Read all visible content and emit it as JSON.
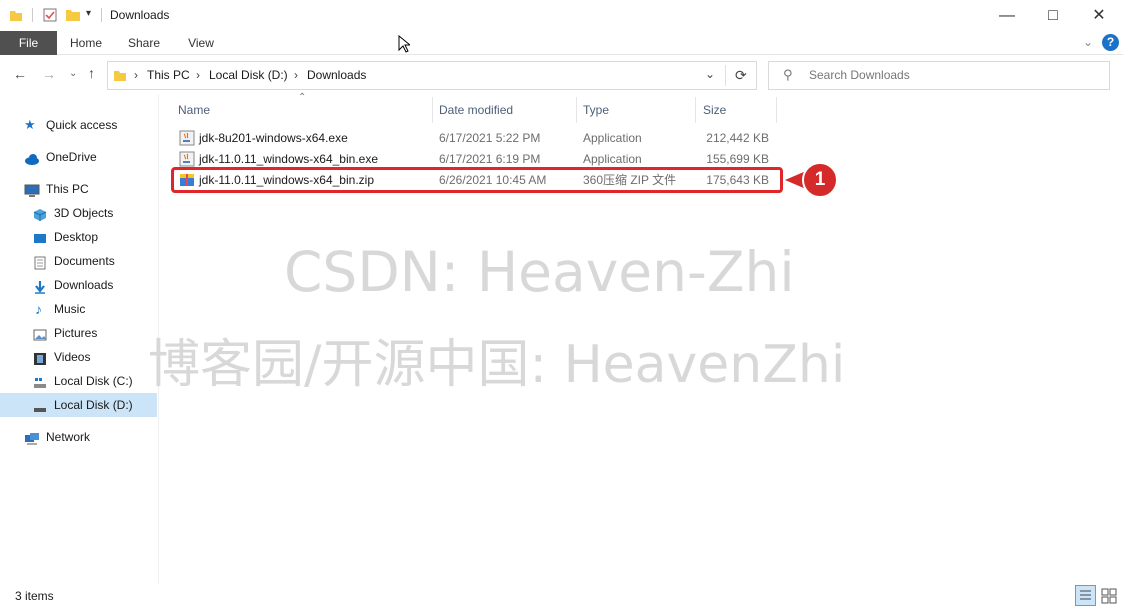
{
  "window": {
    "title": "Downloads"
  },
  "ribbon": {
    "tabs": [
      "File",
      "Home",
      "Share",
      "View"
    ]
  },
  "address": {
    "crumbs": [
      "This PC",
      "Local Disk (D:)",
      "Downloads"
    ]
  },
  "search": {
    "placeholder": "Search Downloads"
  },
  "sidebar": {
    "items": [
      {
        "label": "Quick access"
      },
      {
        "label": "OneDrive"
      },
      {
        "label": "This PC"
      },
      {
        "label": "3D Objects"
      },
      {
        "label": "Desktop"
      },
      {
        "label": "Documents"
      },
      {
        "label": "Downloads"
      },
      {
        "label": "Music"
      },
      {
        "label": "Pictures"
      },
      {
        "label": "Videos"
      },
      {
        "label": "Local Disk (C:)"
      },
      {
        "label": "Local Disk (D:)"
      },
      {
        "label": "Network"
      }
    ]
  },
  "columns": [
    "Name",
    "Date modified",
    "Type",
    "Size"
  ],
  "files": [
    {
      "name": "jdk-8u201-windows-x64.exe",
      "date": "6/17/2021 5:22 PM",
      "type": "Application",
      "size": "212,442 KB"
    },
    {
      "name": "jdk-11.0.11_windows-x64_bin.exe",
      "date": "6/17/2021 6:19 PM",
      "type": "Application",
      "size": "155,699 KB"
    },
    {
      "name": "jdk-11.0.11_windows-x64_bin.zip",
      "date": "6/26/2021 10:45 AM",
      "type": "360压缩 ZIP 文件",
      "size": "175,643 KB"
    }
  ],
  "callout": {
    "number": "1"
  },
  "status": {
    "items_count": "3 items"
  },
  "watermark": {
    "line1": "CSDN: Heaven-Zhi",
    "line2": "博客园/开源中国: HeavenZhi"
  },
  "colors": {
    "highlight": "#e0252b",
    "accent": "#0078d7"
  }
}
